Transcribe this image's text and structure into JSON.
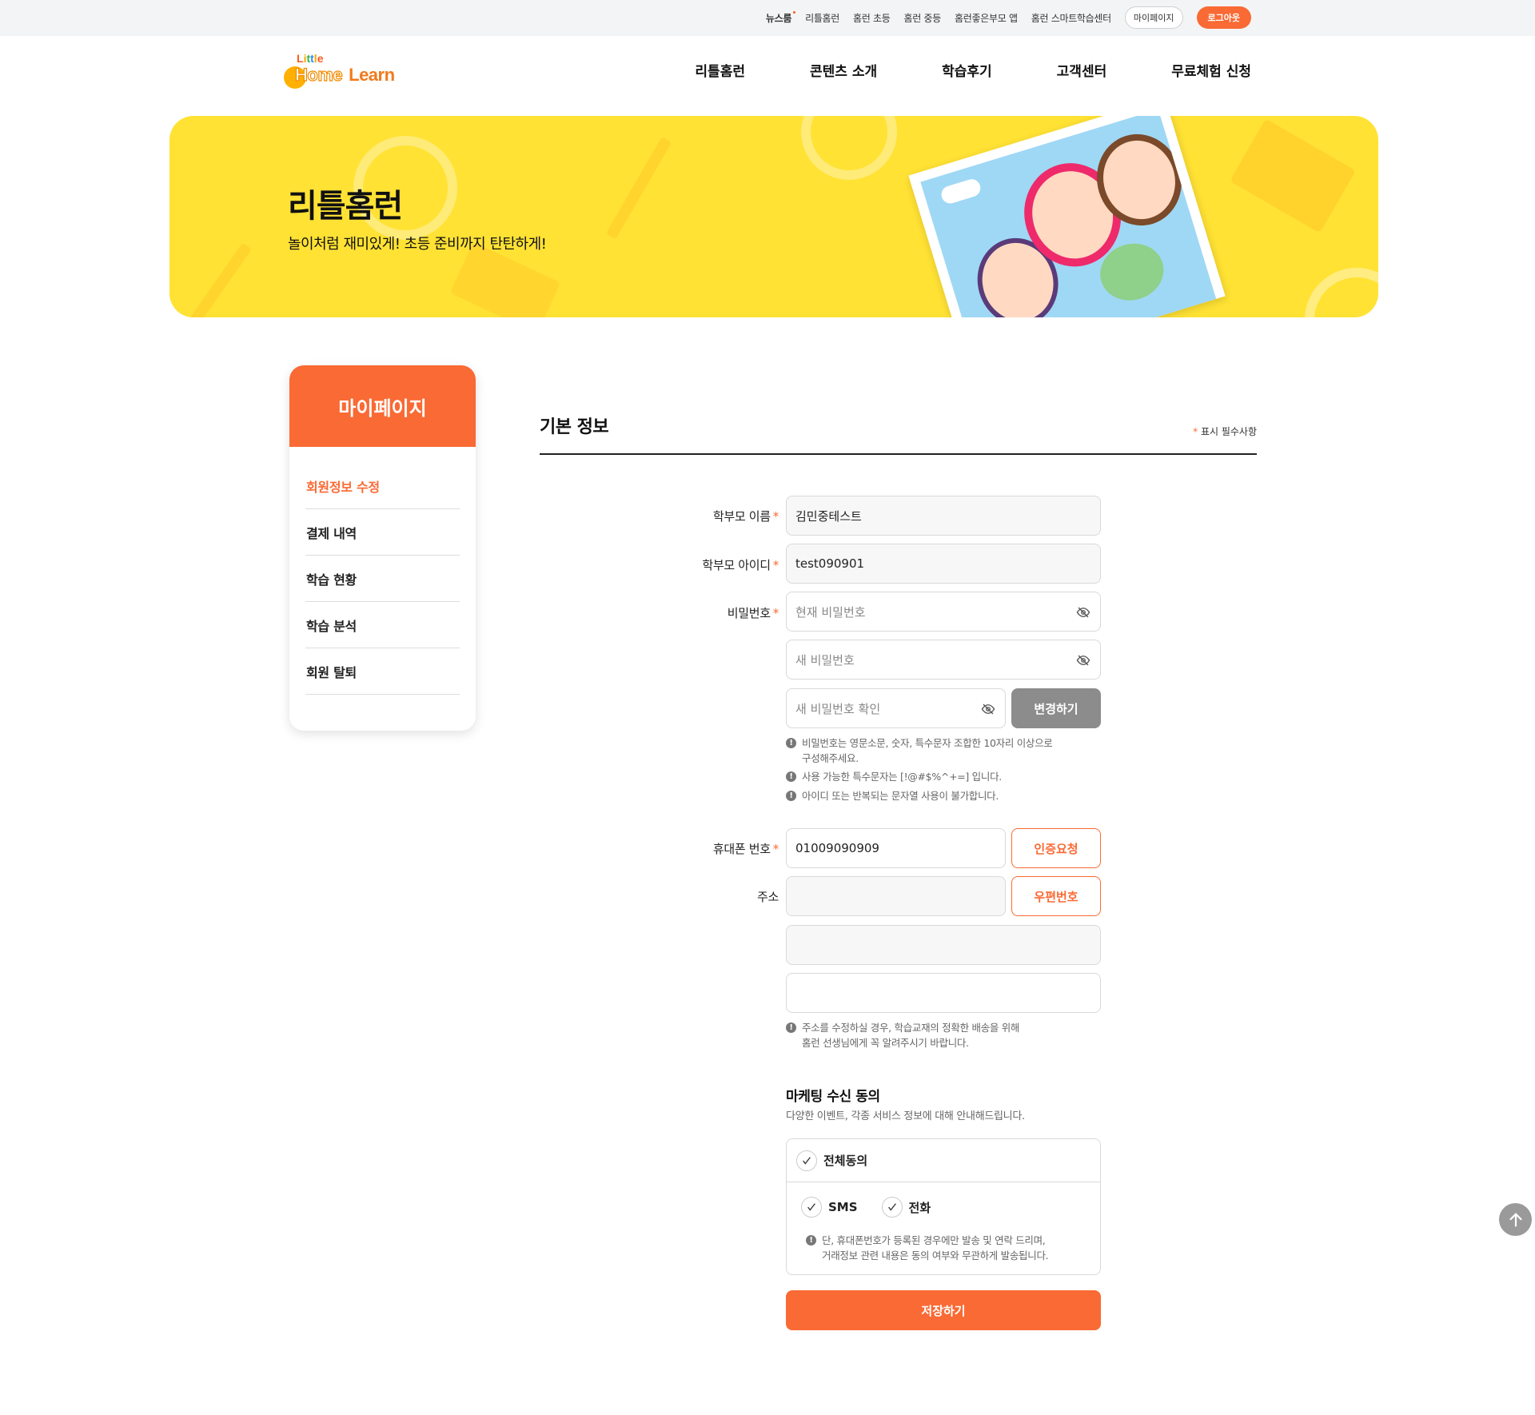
{
  "topbar": {
    "links": [
      "뉴스룸",
      "리틀홈런",
      "홈런 초등",
      "홈런 중등",
      "홈런좋은부모 앱",
      "홈런 스마트학습센터"
    ],
    "mypage_label": "마이페이지",
    "logout_label": "로그아웃"
  },
  "logo": {
    "little": [
      "L",
      "i",
      "t",
      "t",
      "l",
      "e"
    ],
    "home": "Home",
    "learn": "Learn"
  },
  "nav": [
    "리틀홈런",
    "콘텐츠 소개",
    "학습후기",
    "고객센터",
    "무료체험 신청"
  ],
  "hero": {
    "title": "리틀홈런",
    "subtitle": "놀이처럼 재미있게! 초등 준비까지 탄탄하게!"
  },
  "sidebar": {
    "title": "마이페이지",
    "items": [
      "회원정보 수정",
      "결제 내역",
      "학습 현황",
      "학습 분석",
      "회원 탈퇴"
    ],
    "active_index": 0
  },
  "form": {
    "section_title": "기본 정보",
    "required_star": "*",
    "required_note": "표시 필수사항",
    "parent_name_label": "학부모 이름",
    "parent_name_value": "김민중테스트",
    "parent_id_label": "학부모 아이디",
    "parent_id_value": "test090901",
    "password_label": "비밀번호",
    "current_password_placeholder": "현재 비밀번호",
    "new_password_placeholder": "새 비밀번호",
    "confirm_password_placeholder": "새 비밀번호 확인",
    "change_button": "변경하기",
    "password_hints": [
      "비밀번호는 영문소문, 숫자, 특수문자 조합한 10자리 이상으로",
      "구성해주세요.",
      "사용 가능한 특수문자는 [!@#$%^+=] 입니다.",
      "아이디 또는 반복되는 문자열 사용이 불가합니다."
    ],
    "phone_label": "휴대폰 번호",
    "phone_value": "01009090909",
    "verify_button": "인증요청",
    "address_label": "주소",
    "zipcode_button": "우편번호",
    "address_hint": [
      "주소를 수정하실 경우, 학습교재의 정확한 배송을 위해",
      "홈런 선생님에게 꼭 알려주시기 바랍니다."
    ]
  },
  "marketing": {
    "title": "마케팅 수신 동의",
    "subtitle": "다양한 이벤트, 각종 서비스 정보에 대해 안내해드립니다.",
    "all_label": "전체동의",
    "options": [
      "SMS",
      "전화"
    ],
    "note": [
      "단, 휴대폰번호가 등록된 경우에만 발송 및 연락 드리며,",
      "거래정보 관련 내용은 동의 여부와 무관하게 발송됩니다."
    ]
  },
  "save_button": "저장하기",
  "colors": {
    "accent": "#fa6a34",
    "banner": "#ffe234",
    "gray_button": "#8c8c8c"
  }
}
